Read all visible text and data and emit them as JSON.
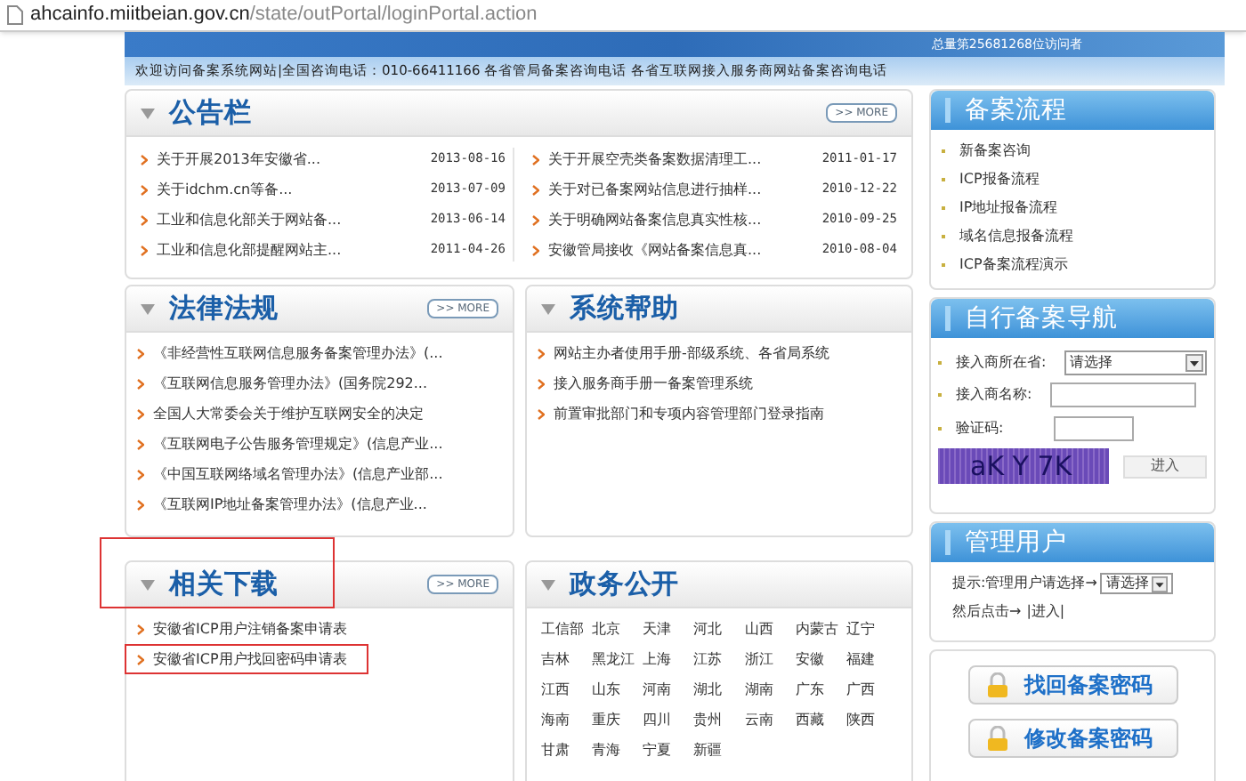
{
  "address_bar": {
    "host": "ahcainfo.miitbeian.gov.cn",
    "path": "/state/outPortal/loginPortal.action"
  },
  "banner": {
    "visitor_count": "总量第25681268位访问者"
  },
  "welcome_bar": "欢迎访问备案系统网站|全国咨询电话：010-66411166 各省管局备案咨询电话 各省互联网接入服务商网站备案咨询电话",
  "notice_board": {
    "title": "公告栏",
    "more": ">> MORE",
    "items": [
      {
        "text": "关于开展2013年安徽省...",
        "date": "2013-08-16"
      },
      {
        "text": "关于idchm.cn等备...",
        "date": "2013-07-09"
      },
      {
        "text": "工业和信息化部关于网站备...",
        "date": "2013-06-14"
      },
      {
        "text": "工业和信息化部提醒网站主...",
        "date": "2011-04-26"
      },
      {
        "text": "关于开展空壳类备案数据清理工...",
        "date": "2011-01-17"
      },
      {
        "text": "关于对已备案网站信息进行抽样...",
        "date": "2010-12-22"
      },
      {
        "text": "关于明确网站备案信息真实性核...",
        "date": "2010-09-25"
      },
      {
        "text": "安徽管局接收《网站备案信息真...",
        "date": "2010-08-04"
      }
    ]
  },
  "laws": {
    "title": "法律法规",
    "more": ">> MORE",
    "items": [
      "《非经营性互联网信息服务备案管理办法》(...",
      "《互联网信息服务管理办法》(国务院292...",
      "全国人大常委会关于维护互联网安全的决定",
      "《互联网电子公告服务管理规定》(信息产业...",
      "《中国互联网络域名管理办法》(信息产业部...",
      "《互联网IP地址备案管理办法》(信息产业..."
    ]
  },
  "system_help": {
    "title": "系统帮助",
    "items": [
      "网站主办者使用手册-部级系统、各省局系统",
      "接入服务商手册一备案管理系统",
      "前置审批部门和专项内容管理部门登录指南"
    ]
  },
  "downloads": {
    "title": "相关下载",
    "more": ">> MORE",
    "highlighted": true,
    "items": [
      {
        "text": "安徽省ICP用户注销备案申请表",
        "highlighted": false
      },
      {
        "text": "安徽省ICP用户找回密码申请表",
        "highlighted": true
      }
    ]
  },
  "gov_affairs": {
    "title": "政务公开",
    "regions": [
      "工信部",
      "北京",
      "天津",
      "河北",
      "山西",
      "内蒙古",
      "辽宁",
      "吉林",
      "黑龙江",
      "上海",
      "江苏",
      "浙江",
      "安徽",
      "福建",
      "江西",
      "山东",
      "河南",
      "湖北",
      "湖南",
      "广东",
      "广西",
      "海南",
      "重庆",
      "四川",
      "贵州",
      "云南",
      "西藏",
      "陕西",
      "甘肃",
      "青海",
      "宁夏",
      "新疆"
    ]
  },
  "filing_process": {
    "title": "备案流程",
    "items": [
      "新备案咨询",
      "ICP报备流程",
      "IP地址报备流程",
      "域名信息报备流程",
      "ICP备案流程演示"
    ]
  },
  "self_navigation": {
    "title": "自行备案导航",
    "province_label": "接入商所在省:",
    "province_value": "请选择",
    "name_label": "接入商名称:",
    "captcha_label": "验证码:",
    "captcha_text": "aK Y 7K",
    "enter_button": "进入"
  },
  "manage_users": {
    "title": "管理用户",
    "hint": "提示:管理用户请选择→",
    "select_value": "请选择",
    "then_click": "然后点击→",
    "enter_link": "|进入|"
  },
  "password_buttons": [
    "找回备案密码",
    "修改备案密码"
  ]
}
